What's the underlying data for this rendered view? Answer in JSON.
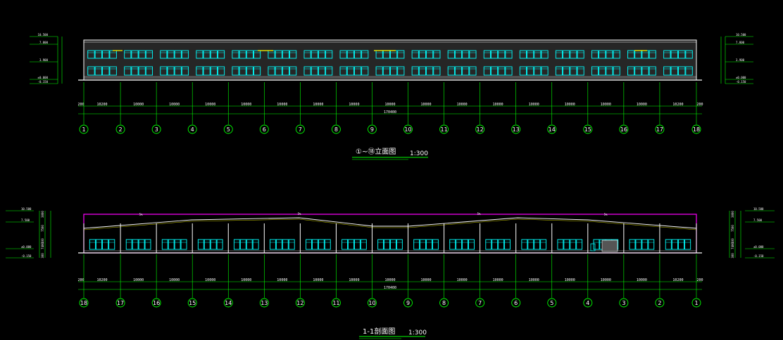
{
  "elevation": {
    "title": "①~⑱立面图",
    "scale": "1:300",
    "axes": [
      "1",
      "2",
      "3",
      "4",
      "5",
      "6",
      "7",
      "8",
      "9",
      "10",
      "11",
      "12",
      "13",
      "14",
      "15",
      "16",
      "17",
      "18"
    ],
    "bays": [
      "10200",
      "10000",
      "10000",
      "10000",
      "10000",
      "10000",
      "10000",
      "10000",
      "10000",
      "10000",
      "10000",
      "10000",
      "10000",
      "10000",
      "10000",
      "10000",
      "10200"
    ],
    "edge_left": "200",
    "edge_right": "200",
    "total": "170400",
    "levels": [
      "10.500",
      "7.800",
      "3.900",
      "±0.000",
      "-0.150"
    ]
  },
  "section": {
    "title": "1-1剖面图",
    "scale": "1:300",
    "axes": [
      "18",
      "17",
      "16",
      "15",
      "14",
      "13",
      "12",
      "11",
      "10",
      "9",
      "8",
      "7",
      "6",
      "5",
      "4",
      "3",
      "2",
      "1"
    ],
    "bays": [
      "10200",
      "10000",
      "10000",
      "10000",
      "10000",
      "10000",
      "10000",
      "10000",
      "10000",
      "10000",
      "10000",
      "10000",
      "10000",
      "10000",
      "10000",
      "10000",
      "10200"
    ],
    "edge_left": "200",
    "edge_right": "200",
    "total": "170400",
    "levels_left": [
      "10.500",
      "7.500",
      "±0.000",
      "-0.150"
    ],
    "levels_right": [
      "10.500",
      "7.500",
      "±0.000",
      "-0.150"
    ],
    "dims_left": [
      "3000",
      "7500",
      "100",
      "7400",
      "300"
    ],
    "dims_right": [
      "3000",
      "7500",
      "100",
      "7400",
      "300"
    ],
    "ridge_labels": [
      "5%",
      "5%",
      "5%",
      "5%"
    ]
  },
  "colors": {
    "background": "#000000",
    "line": "#ffffff",
    "grid": "#00ff00",
    "window": "#00ffff",
    "roof": "#ff00ff",
    "accent": "#ffff00"
  }
}
